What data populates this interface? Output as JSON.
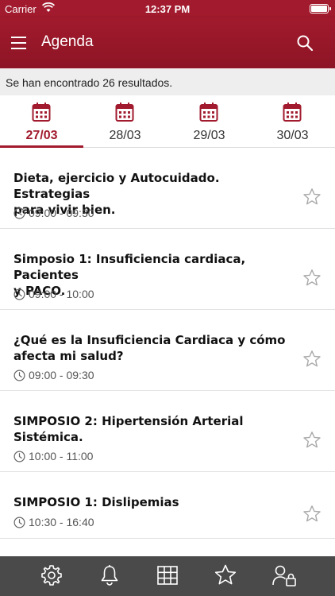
{
  "status_bar": {
    "carrier": "Carrier",
    "time": "12:37 PM"
  },
  "nav": {
    "title": "Agenda"
  },
  "results_text": "Se han encontrado 26 resultados.",
  "date_tabs": [
    {
      "label": "27/03",
      "active": true
    },
    {
      "label": "28/03",
      "active": false
    },
    {
      "label": "29/03",
      "active": false
    },
    {
      "label": "30/03",
      "active": false
    }
  ],
  "sessions": [
    {
      "title_line1": "Dieta, ejercicio y Autocuidado. Estrategias",
      "title_line2": "para vivir bien.",
      "time": "09:00 - 09:30",
      "favorite": false
    },
    {
      "title_line1": "Simposio 1: Insuficiencia cardiaca, Pacientes",
      "title_line2": "y PACO.",
      "time": "09:00 - 10:00",
      "favorite": false
    },
    {
      "title_line1": "¿Qué es la Insuficiencia Cardiaca y cómo",
      "title_line2": "afecta mi salud?",
      "time": "09:00 - 09:30",
      "favorite": false
    },
    {
      "title_line1": "SIMPOSIO 2: Hipertensión Arterial",
      "title_line2": "Sistémica.",
      "time": "10:00 - 11:00",
      "favorite": false
    },
    {
      "title_line1": "SIMPOSIO 1: Dislipemias",
      "title_line2": "",
      "time": "10:30 - 16:40",
      "favorite": false
    }
  ],
  "tab_bar": {
    "icons": [
      "gear-icon",
      "bell-icon",
      "grid-icon",
      "star-icon",
      "user-lock-icon"
    ]
  },
  "colors": {
    "brand": "#a11a2d",
    "tab_bar": "#4a4a4a",
    "results_bg": "#eeeeee"
  }
}
